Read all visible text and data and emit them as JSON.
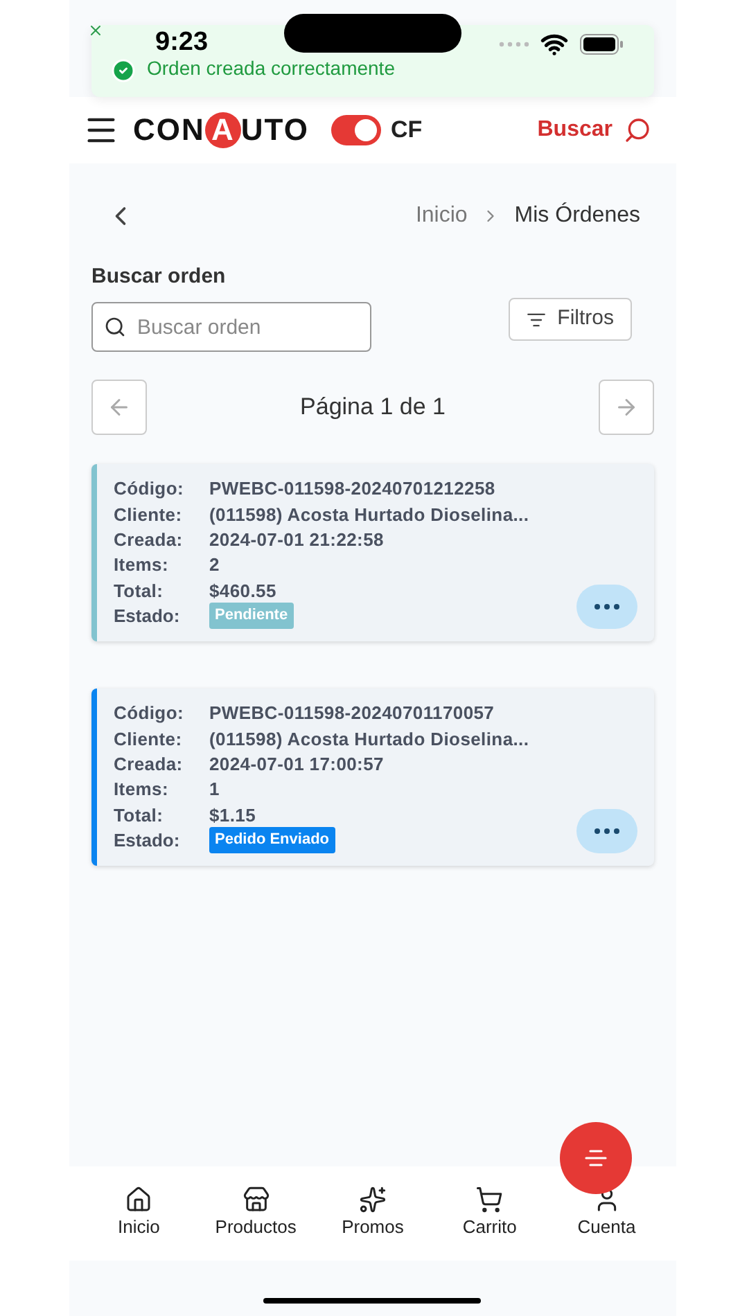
{
  "status_bar": {
    "time": "9:23"
  },
  "toast": {
    "message": "Orden creada correctamente"
  },
  "header": {
    "logo": {
      "start": "CON",
      "accent": "A",
      "end": "UTO"
    },
    "toggle": {
      "on": true,
      "label": "CF"
    },
    "search_label": "Buscar"
  },
  "breadcrumb": [
    {
      "label": "Inicio",
      "selected": false
    },
    {
      "label": "Mis Órdenes",
      "selected": true
    }
  ],
  "search": {
    "label": "Buscar orden",
    "placeholder": "Buscar orden"
  },
  "filters_button": "Filtros",
  "pagination": {
    "label": "Página 1 de 1"
  },
  "orders": [
    {
      "color": "#82c3cf",
      "fields": [
        {
          "label": "Código:",
          "value": "PWEBC-011598-20240701212258"
        },
        {
          "label": "Cliente:",
          "value": "(011598) Acosta Hurtado Dioselina..."
        },
        {
          "label": "Creada:",
          "value": "2024-07-01 21:22:58"
        },
        {
          "label": "Items:",
          "value": "2"
        },
        {
          "label": "Total:",
          "value": "$460.55"
        }
      ],
      "status_label": "Estado:",
      "status": "Pendiente"
    },
    {
      "color": "#0a84f0",
      "fields": [
        {
          "label": "Código:",
          "value": "PWEBC-011598-20240701170057"
        },
        {
          "label": "Cliente:",
          "value": "(011598) Acosta Hurtado Dioselina..."
        },
        {
          "label": "Creada:",
          "value": "2024-07-01 17:00:57"
        },
        {
          "label": "Items:",
          "value": "1"
        },
        {
          "label": "Total:",
          "value": "$1.15"
        }
      ],
      "status_label": "Estado:",
      "status": "Pedido Enviado"
    }
  ],
  "bottom_nav": [
    {
      "kind": "home",
      "label": "Inicio"
    },
    {
      "kind": "store",
      "label": "Productos"
    },
    {
      "kind": "sparkles",
      "label": "Promos"
    },
    {
      "kind": "cart",
      "label": "Carrito"
    },
    {
      "kind": "user",
      "label": "Cuenta"
    }
  ]
}
